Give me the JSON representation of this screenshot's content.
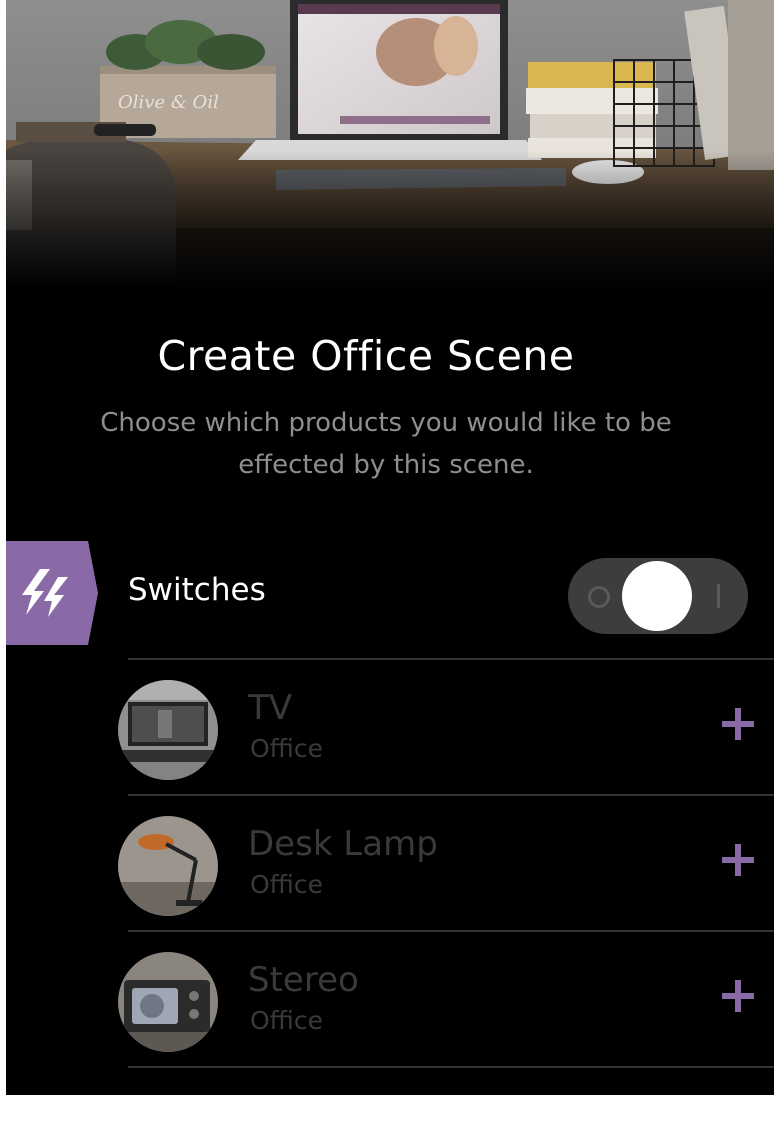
{
  "header": {
    "title": "Create Office Scene",
    "subtitle": "Choose which products you would like to be effected by this scene."
  },
  "category": {
    "label": "Switches",
    "icon": "lightning-bolt-icon",
    "accent_color": "#8a6aa6",
    "toggle_on": true
  },
  "devices": [
    {
      "name": "TV",
      "room": "Office",
      "icon": "tv-thumbnail"
    },
    {
      "name": "Desk Lamp",
      "room": "Office",
      "icon": "desk-lamp-thumbnail"
    },
    {
      "name": "Stereo",
      "room": "Office",
      "icon": "stereo-thumbnail"
    }
  ],
  "colors": {
    "background": "#000000",
    "accent": "#8a6aa6",
    "muted_text": "#3a3a3a"
  }
}
